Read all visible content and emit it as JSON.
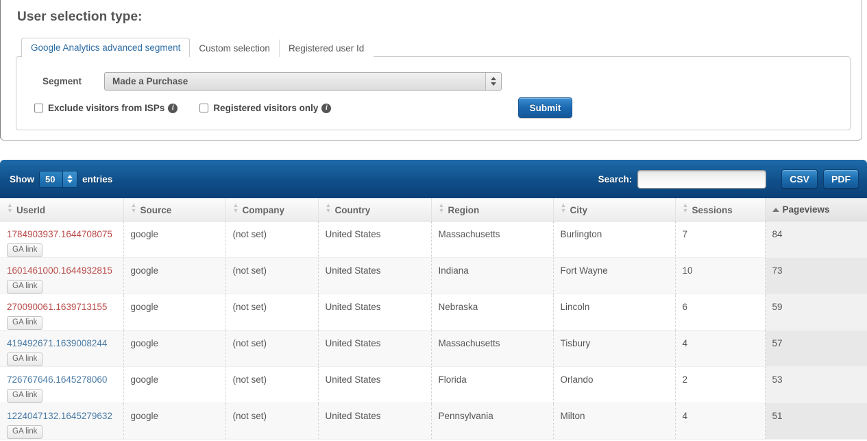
{
  "panel": {
    "title": "User selection type:",
    "tabs": [
      {
        "label": "Google Analytics advanced segment",
        "active": true
      },
      {
        "label": "Custom selection",
        "active": false
      },
      {
        "label": "Registered user Id",
        "active": false
      }
    ],
    "segment_label": "Segment",
    "segment_value": "Made a Purchase",
    "checkboxes": [
      {
        "label": "Exclude visitors from ISPs",
        "checked": false,
        "info": "i"
      },
      {
        "label": "Registered visitors only",
        "checked": false,
        "info": "i"
      }
    ],
    "submit_label": "Submit"
  },
  "datatable": {
    "show_label": "Show",
    "entries_label": "entries",
    "page_length": "50",
    "search_label": "Search:",
    "search_value": "",
    "search_placeholder": "",
    "csv_label": "CSV",
    "pdf_label": "PDF",
    "columns": [
      {
        "label": "UserId",
        "sort": "none"
      },
      {
        "label": "Source",
        "sort": "none"
      },
      {
        "label": "Company",
        "sort": "none"
      },
      {
        "label": "Country",
        "sort": "none"
      },
      {
        "label": "Region",
        "sort": "none"
      },
      {
        "label": "City",
        "sort": "none"
      },
      {
        "label": "Sessions",
        "sort": "none"
      },
      {
        "label": "Pageviews",
        "sort": "asc"
      }
    ],
    "ga_link_label": "GA link",
    "rows": [
      {
        "userid": "1784903937.1644708075",
        "uid_color": "red",
        "source": "google",
        "company": "(not set)",
        "country": "United States",
        "region": "Massachusetts",
        "city": "Burlington",
        "sessions": "7",
        "pageviews": "84"
      },
      {
        "userid": "1601461000.1644932815",
        "uid_color": "red",
        "source": "google",
        "company": "(not set)",
        "country": "United States",
        "region": "Indiana",
        "city": "Fort Wayne",
        "sessions": "10",
        "pageviews": "73"
      },
      {
        "userid": "270090061.1639713155",
        "uid_color": "red",
        "source": "google",
        "company": "(not set)",
        "country": "United States",
        "region": "Nebraska",
        "city": "Lincoln",
        "sessions": "6",
        "pageviews": "59"
      },
      {
        "userid": "419492671.1639008244",
        "uid_color": "blue",
        "source": "google",
        "company": "(not set)",
        "country": "United States",
        "region": "Massachusetts",
        "city": "Tisbury",
        "sessions": "4",
        "pageviews": "57"
      },
      {
        "userid": "726767646.1645278060",
        "uid_color": "blue",
        "source": "google",
        "company": "(not set)",
        "country": "United States",
        "region": "Florida",
        "city": "Orlando",
        "sessions": "2",
        "pageviews": "53"
      },
      {
        "userid": "1224047132.1645279632",
        "uid_color": "blue",
        "source": "google",
        "company": "(not set)",
        "country": "United States",
        "region": "Pennsylvania",
        "city": "Milton",
        "sessions": "4",
        "pageviews": "51"
      }
    ]
  },
  "colors": {
    "toolbar_blue": "#0f4f8a",
    "button_blue": "#1b6cae",
    "link_red": "#b94a48",
    "link_blue": "#4a7ba6",
    "tab_active_text": "#2e6da4"
  }
}
